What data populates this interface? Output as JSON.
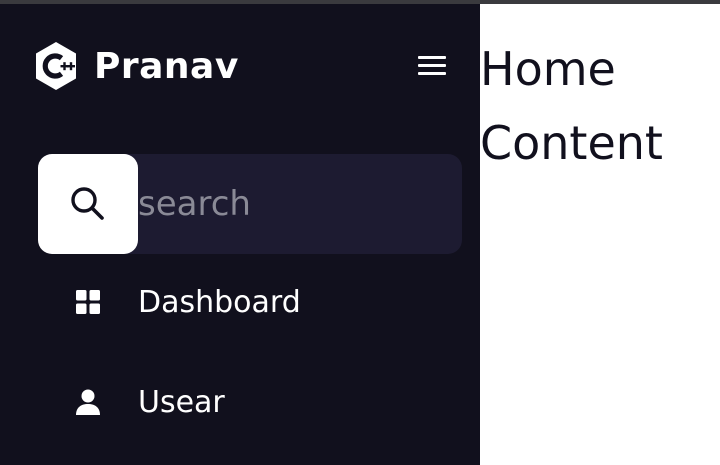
{
  "sidebar": {
    "brand": "Pranav",
    "logo_icon": "cpp-logo-icon",
    "menu_icon": "hamburger-icon",
    "search": {
      "placeholder": "search",
      "value": "",
      "icon": "search-icon"
    },
    "items": [
      {
        "label": "Dashboard",
        "icon": "grid-icon"
      },
      {
        "label": "Usear",
        "icon": "user-icon"
      }
    ]
  },
  "main": {
    "title": "Home Content"
  },
  "colors": {
    "sidebar_bg": "#11101d",
    "search_bg": "#1d1b31",
    "text_dark": "#11101d",
    "text_light": "#ffffff"
  }
}
